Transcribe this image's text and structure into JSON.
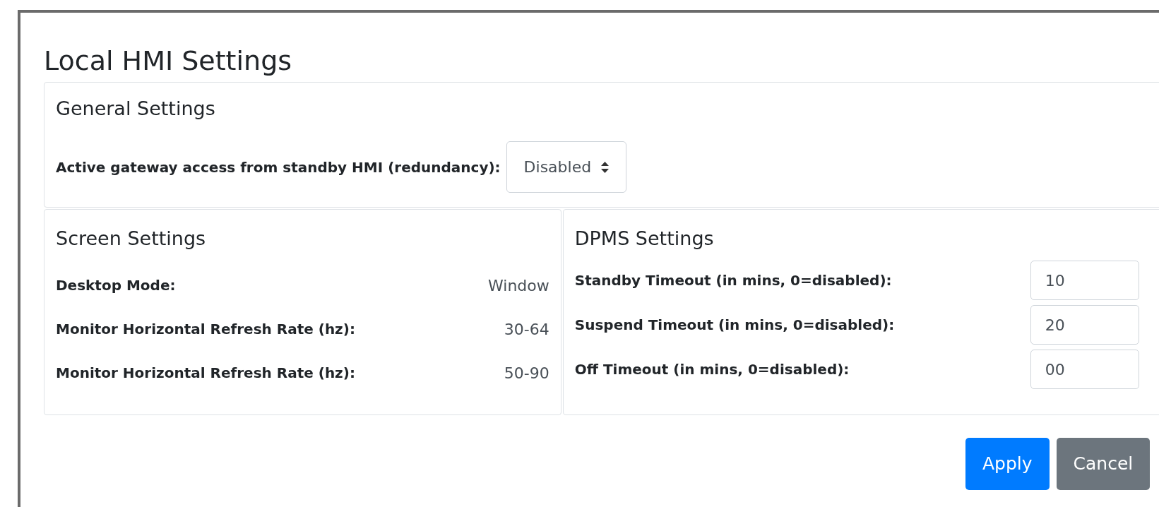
{
  "dialog": {
    "title": "Local HMI Settings"
  },
  "general": {
    "heading": "General Settings",
    "field": {
      "label": "Active gateway access from standby HMI (redundancy):",
      "value": "Disabled"
    }
  },
  "screen": {
    "heading": "Screen Settings",
    "rows": [
      {
        "label": "Desktop Mode:",
        "value": "Window"
      },
      {
        "label": "Monitor Horizontal Refresh Rate (hz):",
        "value": "30-64"
      },
      {
        "label": "Monitor Horizontal Refresh Rate (hz):",
        "value": "50-90"
      }
    ]
  },
  "dpms": {
    "heading": "DPMS Settings",
    "rows": [
      {
        "label": "Standby Timeout (in mins, 0=disabled):",
        "value": "10"
      },
      {
        "label": "Suspend Timeout (in mins, 0=disabled):",
        "value": "20"
      },
      {
        "label": "Off Timeout (in mins, 0=disabled):",
        "value": "00"
      }
    ]
  },
  "buttons": [
    {
      "label": "Apply",
      "kind": "primary"
    },
    {
      "label": "Cancel",
      "kind": "secondary"
    }
  ]
}
